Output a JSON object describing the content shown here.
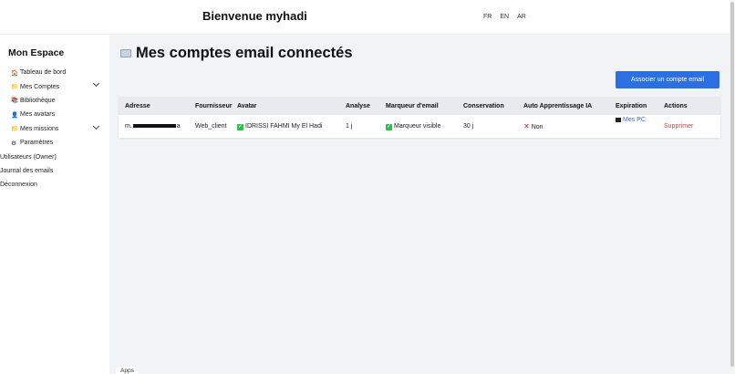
{
  "header": {
    "welcome": "Bienvenue myhadi",
    "langs": [
      "FR",
      "EN",
      "AR"
    ]
  },
  "sidebar": {
    "title": "Mon Espace",
    "items": [
      {
        "label": "Tableau de bord",
        "icon": "dashboard-icon",
        "glyph": "🏠"
      },
      {
        "label": "Mes Comptes",
        "icon": "folder-icon",
        "glyph": "📁"
      },
      {
        "label": "Bibliothèque",
        "icon": "books-icon",
        "glyph": "📚"
      },
      {
        "label": "Mes avatars",
        "icon": "user-icon",
        "glyph": "👤"
      },
      {
        "label": "Mes missions",
        "icon": "folder-icon",
        "glyph": "📁"
      },
      {
        "label": "Paramètres",
        "icon": "gear-icon",
        "glyph": "⚙"
      },
      {
        "label": "Utilisateurs (Owner)",
        "icon": "",
        "glyph": ""
      },
      {
        "label": "Journal des emails",
        "icon": "",
        "glyph": ""
      },
      {
        "label": "Déconnexion",
        "icon": "",
        "glyph": ""
      }
    ]
  },
  "main": {
    "title": "Mes comptes email connectés",
    "associate_button": "Associer un compte email",
    "columns": [
      "Adresse",
      "Fournisseur",
      "Avatar",
      "Analyse",
      "Marqueur d'email",
      "Conservation",
      "Auto Apprentissage IA",
      "Expiration",
      "Actions"
    ],
    "rows": [
      {
        "address_start": "m.",
        "address_end": "a",
        "provider": "Web_client",
        "avatar": "IDRISSI FAHMI My El Hadi",
        "analysis": "1 j",
        "marker": "Marqueur visible",
        "retention": "30 j",
        "ai_learning": "Non",
        "expiration": "Mes PC",
        "action": "Supprimer"
      }
    ]
  },
  "footer": {
    "apps": "Apps"
  },
  "colors": {
    "accent": "#2b6fe0",
    "danger": "#e23b2b",
    "success": "#2fbf4f",
    "main_bg": "#f2f3f5"
  }
}
